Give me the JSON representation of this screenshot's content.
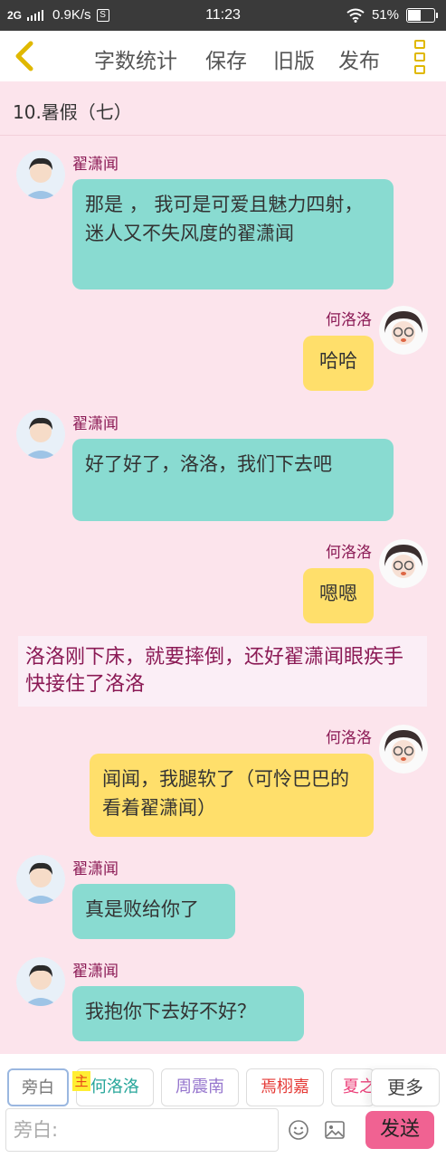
{
  "status": {
    "signal": "2G",
    "speed": "0.9K/s",
    "sim_badge": "S",
    "time": "11:23",
    "battery": "51%",
    "battery_level": 0.51
  },
  "toolbar": {
    "word_count": "字数统计",
    "save": "保存",
    "old_version": "旧版",
    "publish": "发布"
  },
  "chapter": {
    "title": "10.暑假（七）"
  },
  "messages": [
    {
      "speaker": "翟潇闻",
      "text": "那是 ， 我可是可爱且魅力四射，迷人又不失风度的翟潇闻"
    },
    {
      "speaker": "何洛洛",
      "text": "哈哈"
    },
    {
      "speaker": "翟潇闻",
      "text": "好了好了，洛洛，我们下去吧"
    },
    {
      "speaker": "何洛洛",
      "text": "嗯嗯"
    },
    {
      "narration": "洛洛刚下床，就要摔倒，还好翟潇闻眼疾手快接住了洛洛"
    },
    {
      "speaker": "何洛洛",
      "text": "闻闻，我腿软了（可怜巴巴的看着翟潇闻）"
    },
    {
      "speaker": "翟潇闻",
      "text": "真是败给你了"
    },
    {
      "speaker": "翟潇闻",
      "text": "我抱你下去好不好？"
    }
  ],
  "characters": {
    "narrator": "旁白",
    "main_badge": "主",
    "list": [
      {
        "label": "何洛洛",
        "color": "#26a69a"
      },
      {
        "label": "周震南",
        "color": "#9575cd"
      },
      {
        "label": "焉栩嘉",
        "color": "#e53935"
      },
      {
        "label": "夏之光",
        "color": "#ec407a"
      }
    ],
    "more": "更多"
  },
  "composer": {
    "placeholder": "旁白:",
    "send": "发送"
  },
  "colors": {
    "teal_bubble": "#89dbd1",
    "yellow_bubble": "#ffdf6b",
    "name_color": "#8b1a55",
    "background": "#fce4ec",
    "send_button": "#f06292"
  }
}
